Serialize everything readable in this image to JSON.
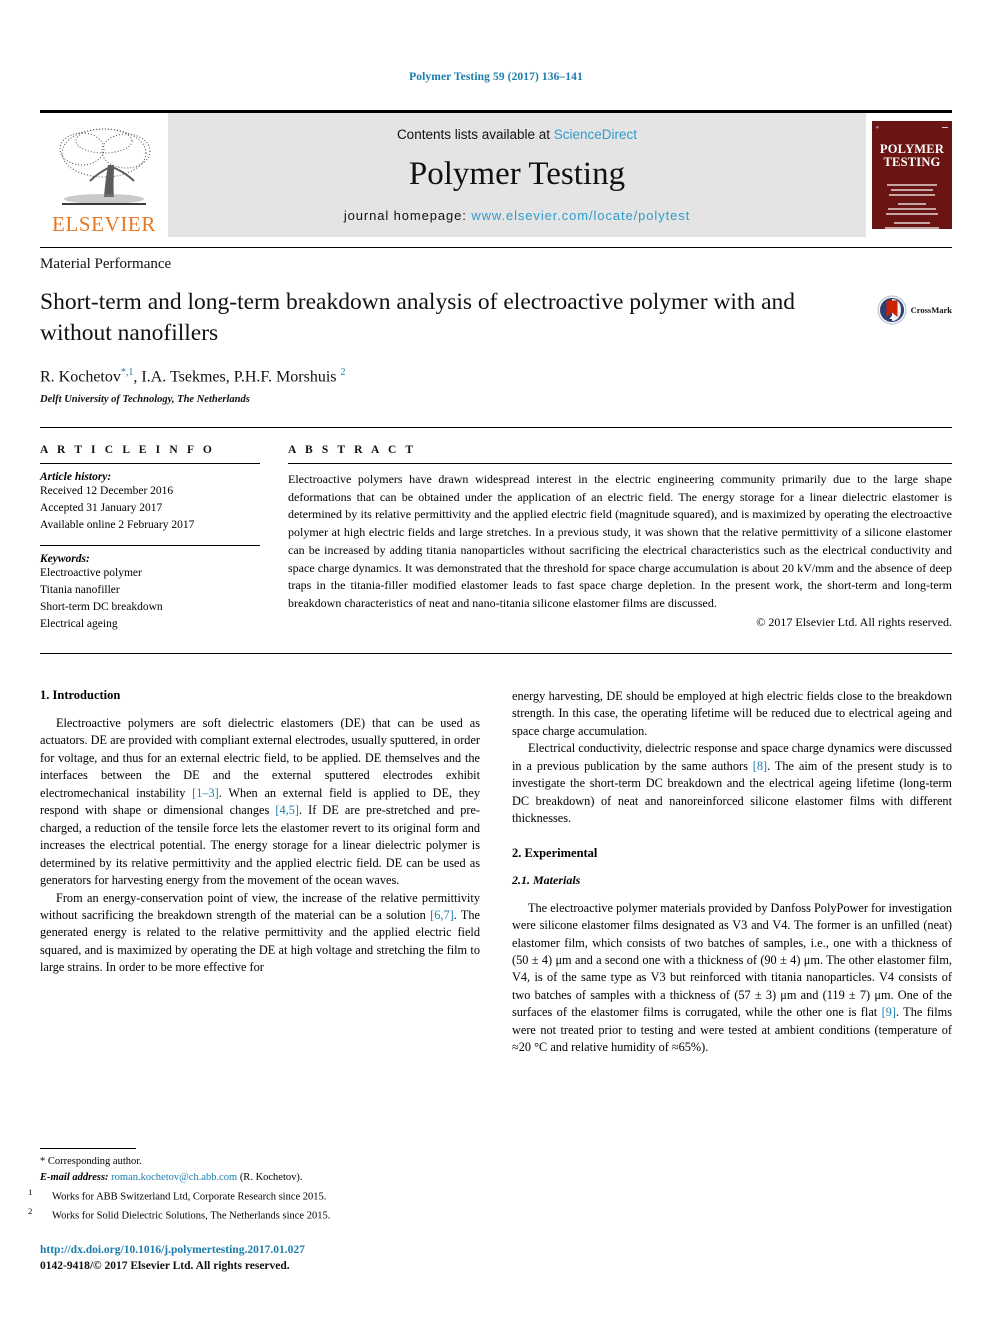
{
  "running_head": "Polymer Testing 59 (2017) 136–141",
  "masthead": {
    "publisher_name": "ELSEVIER",
    "contents_prefix": "Contents lists available at ",
    "contents_link": "ScienceDirect",
    "journal_name": "Polymer Testing",
    "homepage_prefix": "journal homepage: ",
    "homepage_url": "www.elsevier.com/locate/polytest",
    "cover_title_line1": "POLYMER",
    "cover_title_line2": "TESTING"
  },
  "topic": "Material Performance",
  "title": "Short-term and long-term breakdown analysis of electroactive polymer with and without nanofillers",
  "authors": {
    "a1_name": "R. Kochetov",
    "a1_sup": "*,1",
    "a2_name": "I.A. Tsekmes",
    "a3_name": "P.H.F. Morshuis",
    "a3_sup": "2"
  },
  "affiliation": "Delft University of Technology, The Netherlands",
  "crossmark_label": "CrossMark",
  "article_info": {
    "heading": "A R T I C L E   I N F O",
    "history_label": "Article history:",
    "history": [
      "Received 12 December 2016",
      "Accepted 31 January 2017",
      "Available online 2 February 2017"
    ],
    "keywords_label": "Keywords:",
    "keywords": [
      "Electroactive polymer",
      "Titania nanofiller",
      "Short-term DC breakdown",
      "Electrical ageing"
    ]
  },
  "abstract": {
    "heading": "A B S T R A C T",
    "text": "Electroactive polymers have drawn widespread interest in the electric engineering community primarily due to the large shape deformations that can be obtained under the application of an electric field. The energy storage for a linear dielectric elastomer is determined by its relative permittivity and the applied electric field (magnitude squared), and is maximized by operating the electroactive polymer at high electric fields and large stretches. In a previous study, it was shown that the relative permittivity of a silicone elastomer can be increased by adding titania nanoparticles without sacrificing the electrical characteristics such as the electrical conductivity and space charge dynamics. It was demonstrated that the threshold for space charge accumulation is about 20 kV/mm and the absence of deep traps in the titania-filler modified elastomer leads to fast space charge depletion. In the present work, the short-term and long-term breakdown characteristics of neat and nano-titania silicone elastomer films are discussed.",
    "copyright": "© 2017 Elsevier Ltd. All rights reserved."
  },
  "body": {
    "intro_heading": "1. Introduction",
    "intro_p1_a": "Electroactive polymers are soft dielectric elastomers (DE) that can be used as actuators. DE are provided with compliant external electrodes, usually sputtered, in order for voltage, and thus for an external electric field, to be applied. DE themselves and the interfaces between the DE and the external sputtered electrodes exhibit electromechanical instability ",
    "intro_p1_ref1": "[1–3]",
    "intro_p1_b": ". When an external field is applied to DE, they respond with shape or dimensional changes ",
    "intro_p1_ref2": "[4,5]",
    "intro_p1_c": ". If DE are pre-stretched and pre-charged, a reduction of the tensile force lets the elastomer revert to its original form and increases the electrical potential. The energy storage for a linear dielectric polymer is determined by its relative permittivity and the applied electric field. DE can be used as generators for harvesting energy from the movement of the ocean waves.",
    "intro_p2_a": "From an energy-conservation point of view, the increase of the relative permittivity without sacrificing the breakdown strength of the material can be a solution ",
    "intro_p2_ref": "[6,7]",
    "intro_p2_b": ". The generated energy is related to the relative permittivity and the applied electric field squared, and is maximized by operating the DE at high voltage and stretching the film to large strains. In order to be more effective for",
    "intro_p3": "energy harvesting, DE should be employed at high electric fields close to the breakdown strength. In this case, the operating lifetime will be reduced due to electrical ageing and space charge accumulation.",
    "intro_p4_a": "Electrical conductivity, dielectric response and space charge dynamics were discussed in a previous publication by the same authors ",
    "intro_p4_ref": "[8]",
    "intro_p4_b": ". The aim of the present study is to investigate the short-term DC breakdown and the electrical ageing lifetime (long-term DC breakdown) of neat and nanoreinforced silicone elastomer films with different thicknesses.",
    "exp_heading": "2. Experimental",
    "materials_heading": "2.1. Materials",
    "materials_p_a": "The electroactive polymer materials provided by Danfoss PolyPower for investigation were silicone elastomer films designated as V3 and V4. The former is an unfilled (neat) elastomer film, which consists of two batches of samples, i.e., one with a thickness of (50 ± 4) μm and a second one with a thickness of (90 ± 4) μm. The other elastomer film, V4, is of the same type as V3 but reinforced with titania nanoparticles. V4 consists of two batches of samples with a thickness of (57 ± 3) μm and (119 ± 7) μm. One of the surfaces of the elastomer films is corrugated, while the other one is flat ",
    "materials_p_ref": "[9]",
    "materials_p_b": ". The films were not treated prior to testing and were tested at ambient conditions (temperature of ≈20 °C and relative humidity of ≈65%)."
  },
  "footnotes": {
    "corresponding": "* Corresponding author.",
    "email_label": "E-mail address: ",
    "email": "roman.kochetov@ch.abb.com",
    "email_suffix": " (R. Kochetov).",
    "fn1_marker": "1",
    "fn1": "Works for ABB Switzerland Ltd, Corporate Research since 2015.",
    "fn2_marker": "2",
    "fn2": "Works for Solid Dielectric Solutions, The Netherlands since 2015.",
    "doi": "http://dx.doi.org/10.1016/j.polymertesting.2017.01.027",
    "issn": "0142-9418/© 2017 Elsevier Ltd. All rights reserved."
  },
  "colors": {
    "link": "#1a7dad",
    "sciencedirect": "#2e9ccc",
    "elsevier_orange": "#e87722",
    "cover_maroon": "#6b1414"
  }
}
